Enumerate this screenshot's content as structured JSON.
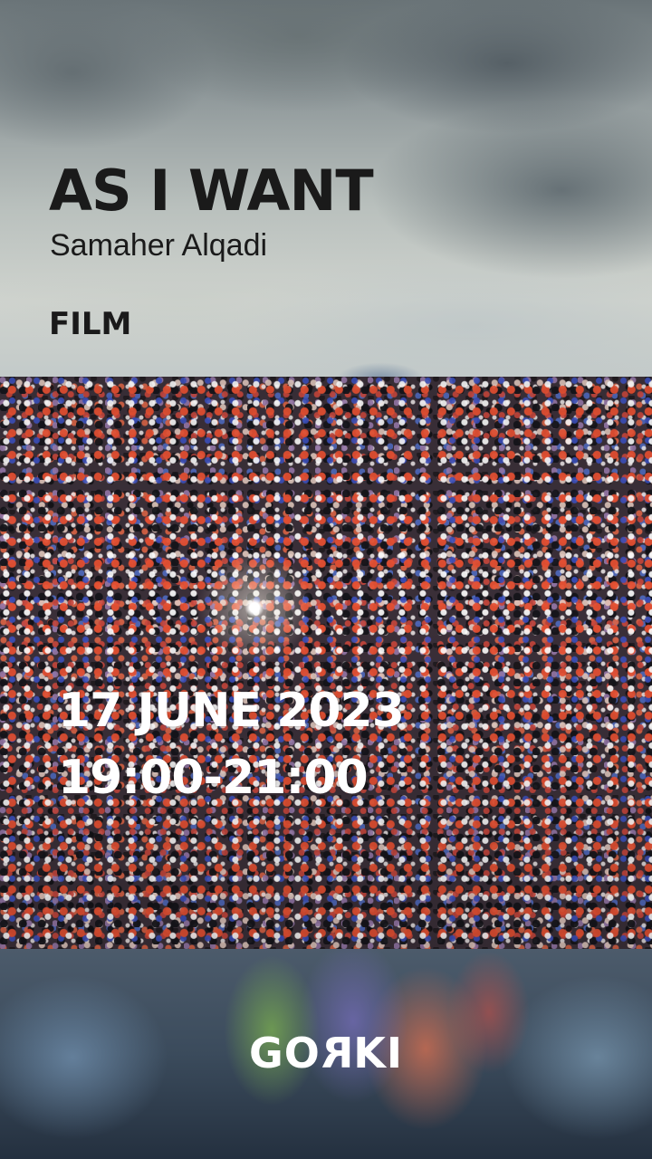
{
  "event": {
    "title": "AS I WANT",
    "artist": "Samaher Alqadi",
    "category": "FILM",
    "date": "17 JUNE 2023",
    "time": "19:00-21:00"
  },
  "logo": {
    "text": "GORKI",
    "part_before": "GO",
    "mirrored_letter": "R",
    "part_after": "KI"
  },
  "colors": {
    "text_dark": "#1a1a1a",
    "text_light": "#ffffff",
    "sky": "#b9c0bd",
    "street": "#3b4b5c"
  }
}
